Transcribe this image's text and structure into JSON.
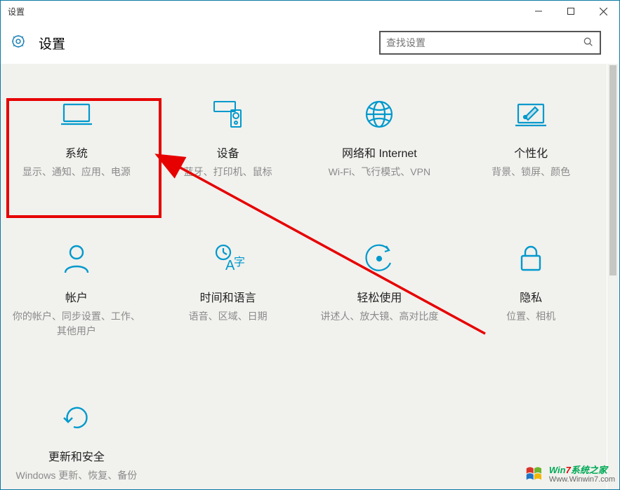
{
  "window": {
    "title": "设置"
  },
  "header": {
    "app_title": "设置"
  },
  "search": {
    "placeholder": "查找设置"
  },
  "tiles": [
    {
      "title": "系统",
      "desc": "显示、通知、应用、电源"
    },
    {
      "title": "设备",
      "desc": "蓝牙、打印机、鼠标"
    },
    {
      "title": "网络和 Internet",
      "desc": "Wi-Fi、飞行模式、VPN"
    },
    {
      "title": "个性化",
      "desc": "背景、锁屏、颜色"
    },
    {
      "title": "帐户",
      "desc": "你的帐户、同步设置、工作、其他用户"
    },
    {
      "title": "时间和语言",
      "desc": "语音、区域、日期"
    },
    {
      "title": "轻松使用",
      "desc": "讲述人、放大镜、高对比度"
    },
    {
      "title": "隐私",
      "desc": "位置、相机"
    },
    {
      "title": "更新和安全",
      "desc": "Windows 更新、恢复、备份"
    }
  ],
  "watermark": {
    "line1_a": "Win",
    "line1_b": "7",
    "line1_c": "系统之家",
    "line2": "Www.Winwin7.com"
  }
}
